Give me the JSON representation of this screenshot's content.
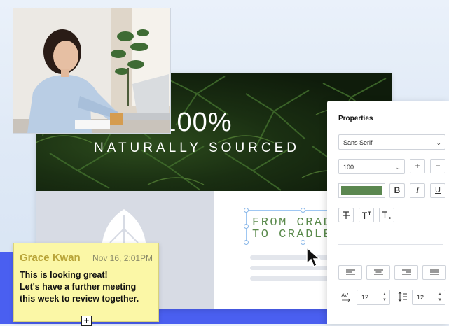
{
  "hero": {
    "headline": "100%",
    "subline": "NATURALLY SOURCED"
  },
  "design_text": {
    "line1": "FROM CRAD",
    "line2": "TO CRADLE"
  },
  "note": {
    "author": "Grace Kwan",
    "date": "Nov 16, 2:01PM",
    "lines": [
      "This is looking great!",
      "Let's have a further meeting",
      "this week to review together."
    ],
    "add_symbol": "+"
  },
  "properties": {
    "title": "Properties",
    "font_family": "Sans Serif",
    "font_size": "100",
    "increase_label": "+",
    "decrease_label": "−",
    "color": "#5b8750",
    "bold_label": "B",
    "italic_label": "I",
    "underline_label": "U",
    "letter_spacing": "12",
    "line_height": "12"
  },
  "colors": {
    "accent_blue": "#4a5ff0",
    "note_yellow": "#fbf7a6",
    "text_green": "#5a8a4c"
  }
}
